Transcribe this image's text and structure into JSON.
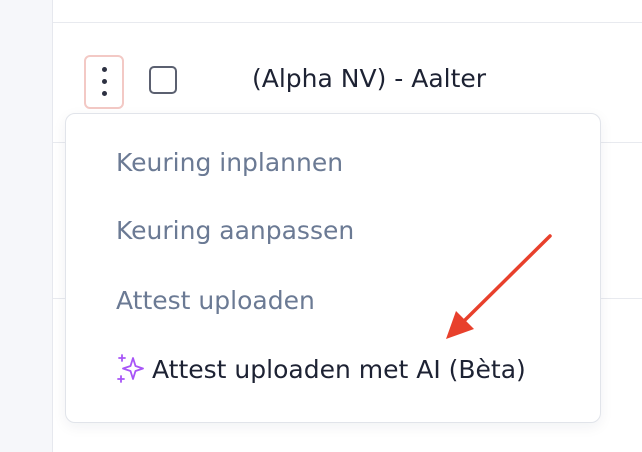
{
  "row": {
    "title": "(Alpha NV) - Aalter"
  },
  "menu": {
    "items": [
      {
        "label": "Keuring inplannen"
      },
      {
        "label": "Keuring aanpassen"
      },
      {
        "label": "Attest uploaden"
      },
      {
        "label": "Attest uploaden met AI (Bèta)",
        "icon": "sparkle-icon"
      }
    ]
  },
  "colors": {
    "accent_purple": "#a855f7",
    "arrow_red": "#e8402c",
    "kebab_border": "#f3c9c5",
    "menu_text_muted": "#6b7a94",
    "menu_text_dark": "#1d2233"
  }
}
